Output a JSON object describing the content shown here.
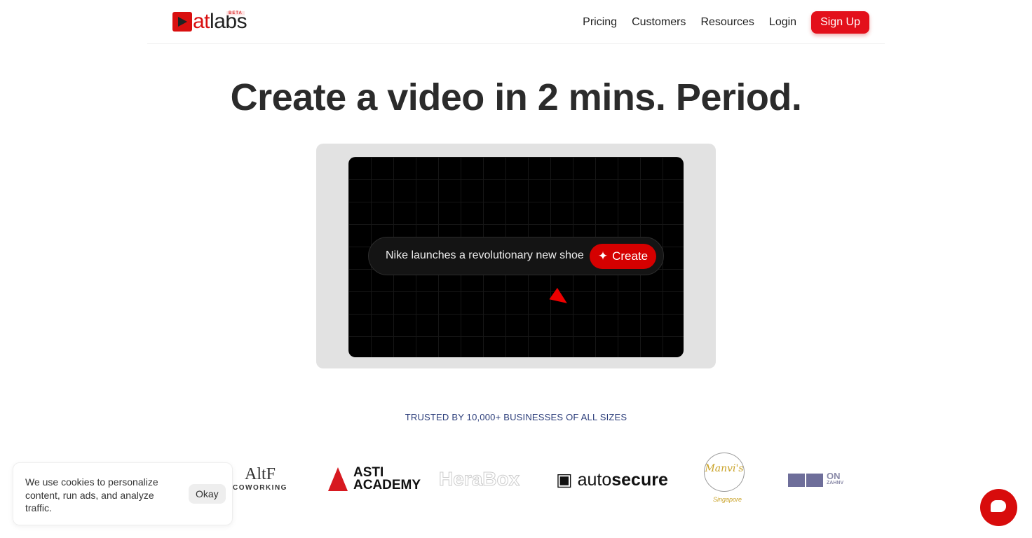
{
  "nav": {
    "logo": {
      "text_a": "at",
      "text_b": "labs",
      "badge": "BETA"
    },
    "links": [
      "Pricing",
      "Customers",
      "Resources",
      "Login"
    ],
    "signup": "Sign Up"
  },
  "hero": {
    "title": "Create a video in 2 mins. Period.",
    "prompt": "Nike launches a revolutionary new shoe",
    "create": "Create"
  },
  "trusted": "TRUSTED BY 10,000+ BUSINESSES OF ALL SIZES",
  "logos": {
    "altf": "AltF",
    "altf_sub": "COWORKING",
    "asti": "ASTI",
    "asti2": "ACADEMY",
    "herabox": "HeraBox",
    "autosecure_a": "auto",
    "autosecure_b": "secure",
    "manvis": "Manvi's",
    "manvis_sub": "Singapore",
    "ont": "ON",
    "ont_sub": "ZAHNV"
  },
  "cookie": {
    "text": "We use cookies to personalize content, run ads, and analyze traffic.",
    "okay": "Okay"
  },
  "colors": {
    "brand": "#e3101b",
    "trusted": "#2b3d7a"
  }
}
